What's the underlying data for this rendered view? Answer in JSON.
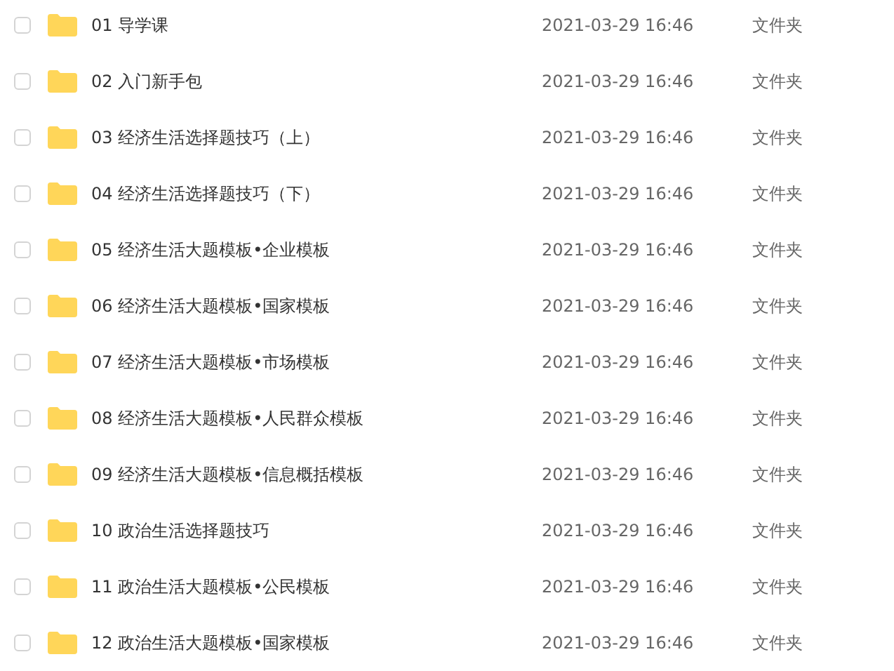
{
  "files": [
    {
      "name": "01 导学课",
      "date": "2021-03-29 16:46",
      "type": "文件夹",
      "checked": false
    },
    {
      "name": "02 入门新手包",
      "date": "2021-03-29 16:46",
      "type": "文件夹",
      "checked": false
    },
    {
      "name": "03 经济生活选择题技巧（上）",
      "date": "2021-03-29 16:46",
      "type": "文件夹",
      "checked": false
    },
    {
      "name": "04 经济生活选择题技巧（下）",
      "date": "2021-03-29 16:46",
      "type": "文件夹",
      "checked": false
    },
    {
      "name": "05 经济生活大题模板•企业模板",
      "date": "2021-03-29 16:46",
      "type": "文件夹",
      "checked": false
    },
    {
      "name": "06 经济生活大题模板•国家模板",
      "date": "2021-03-29 16:46",
      "type": "文件夹",
      "checked": false
    },
    {
      "name": "07 经济生活大题模板•市场模板",
      "date": "2021-03-29 16:46",
      "type": "文件夹",
      "checked": false
    },
    {
      "name": "08 经济生活大题模板•人民群众模板",
      "date": "2021-03-29 16:46",
      "type": "文件夹",
      "checked": false
    },
    {
      "name": "09 经济生活大题模板•信息概括模板",
      "date": "2021-03-29 16:46",
      "type": "文件夹",
      "checked": false
    },
    {
      "name": "10 政治生活选择题技巧",
      "date": "2021-03-29 16:46",
      "type": "文件夹",
      "checked": false
    },
    {
      "name": "11 政治生活大题模板•公民模板",
      "date": "2021-03-29 16:46",
      "type": "文件夹",
      "checked": false
    },
    {
      "name": "12 政治生活大题模板•国家模板",
      "date": "2021-03-29 16:46",
      "type": "文件夹",
      "checked": false
    }
  ]
}
